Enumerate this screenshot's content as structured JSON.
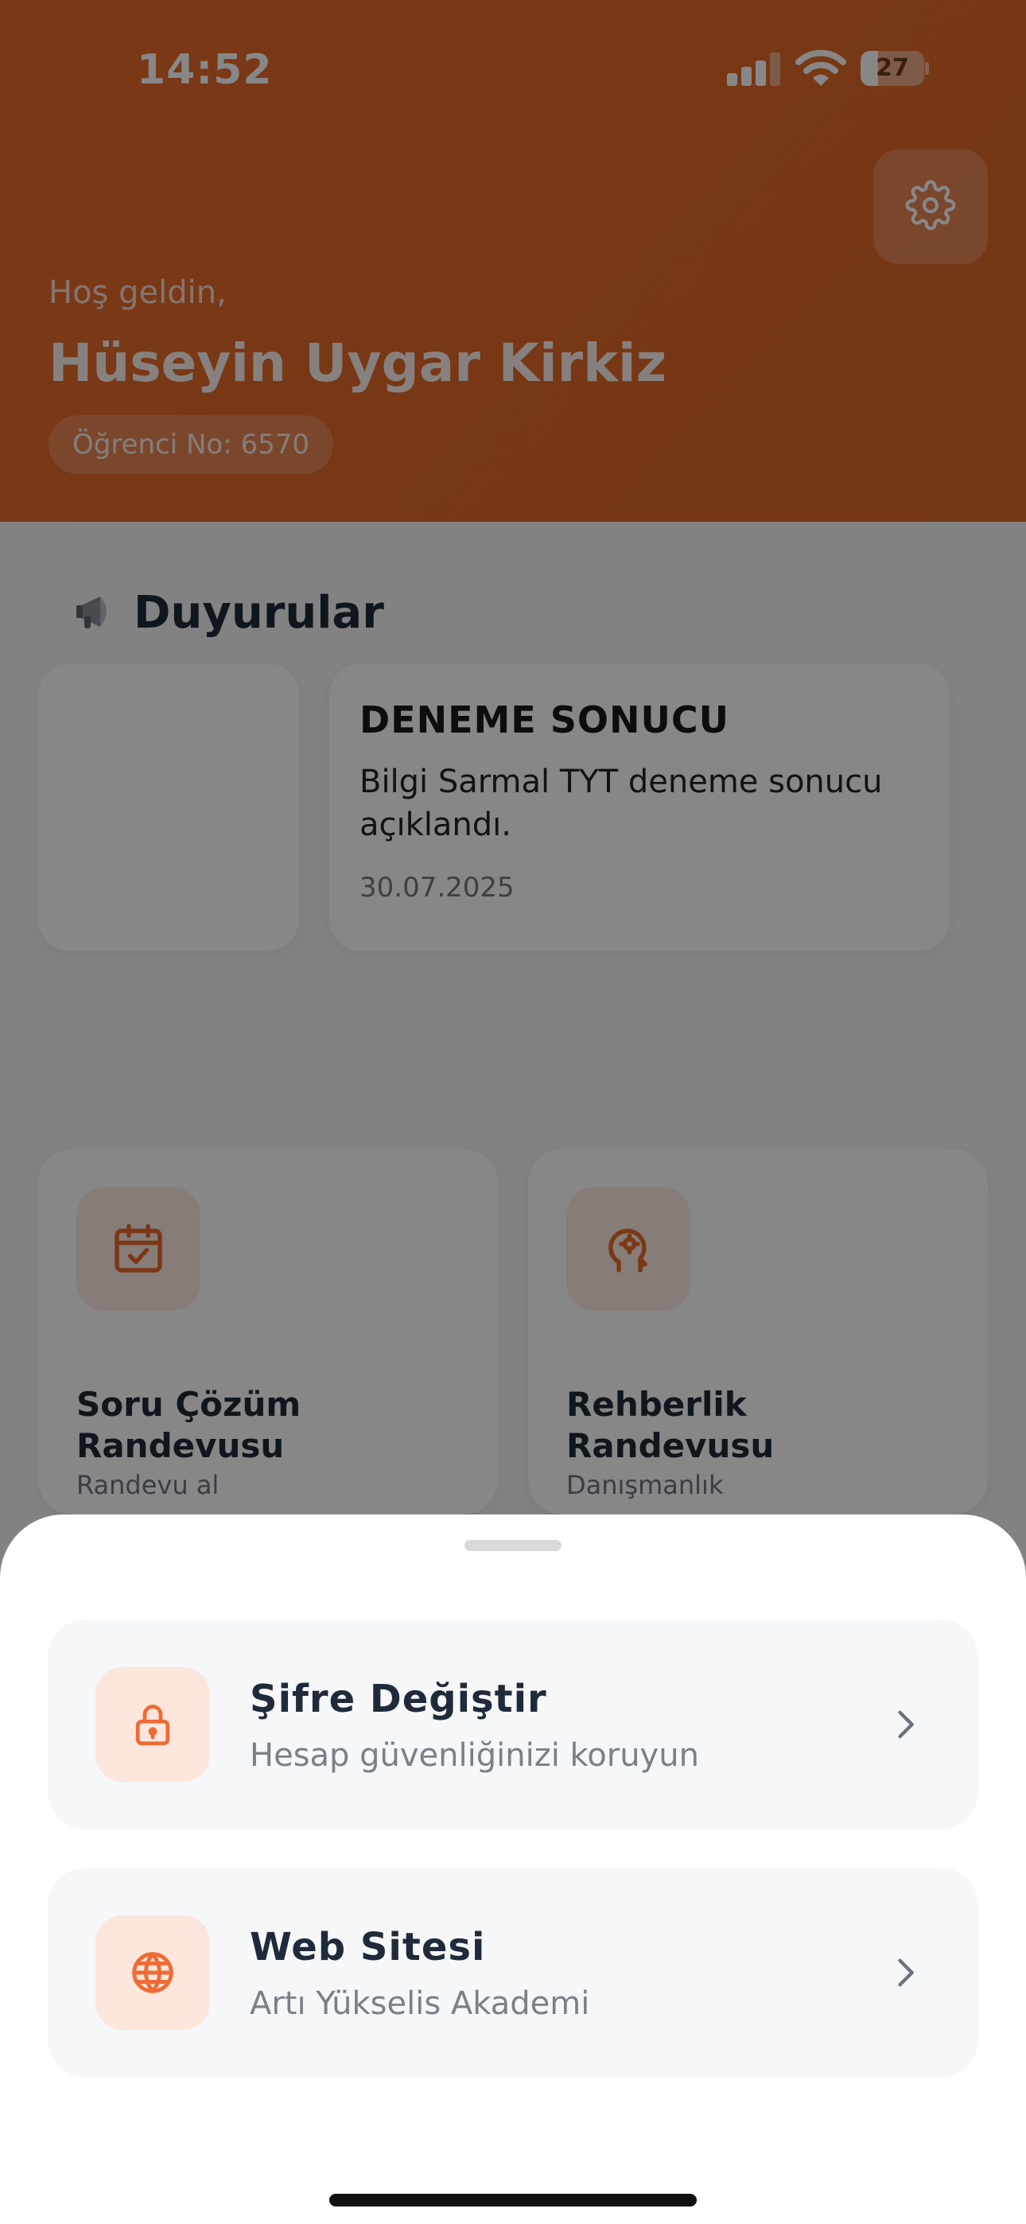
{
  "status_bar": {
    "time": "14:52",
    "battery": "27",
    "battery_level": 0.27
  },
  "header": {
    "welcome": "Hoş geldin,",
    "student_name": "Hüseyin Uygar Kirkiz",
    "student_no": "Öğrenci No: 6570",
    "settings_icon": "gear-icon"
  },
  "announcements": {
    "title": "Duyurular",
    "icon": "megaphone-icon",
    "items": [
      {
        "title": "DENEME SONUCU",
        "body": "Bilgi Sarmal TYT deneme sonucu açıklandı.",
        "date": "30.07.2025"
      }
    ]
  },
  "tiles": [
    {
      "title": "Soru Çözüm Randevusu",
      "subtitle": "Randevu al",
      "icon": "calendar-check-icon"
    },
    {
      "title": "Rehberlik Randevusu",
      "subtitle": "Danışmanlık",
      "icon": "head-gear-icon"
    }
  ],
  "sheet": {
    "options": [
      {
        "title": "Şifre Değiştir",
        "subtitle": "Hesap güvenliğinizi koruyun",
        "icon": "lock-icon"
      },
      {
        "title": "Web Sitesi",
        "subtitle": "Artı Yükselis Akademi",
        "icon": "globe-icon"
      }
    ]
  },
  "colors": {
    "accent": "#E8692B",
    "icon_bg": "#FDE6DC",
    "text_dark": "#1F2A3A",
    "text_muted": "#7A808A"
  }
}
